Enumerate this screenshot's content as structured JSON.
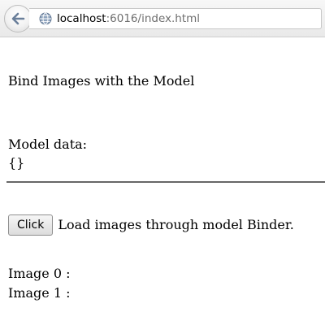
{
  "browser": {
    "url_host": "localhost",
    "url_rest": ":6016/index.html",
    "back_icon": "back-arrow-icon",
    "site_icon": "globe-icon"
  },
  "page": {
    "heading": "Bind Images with the Model",
    "model_label": "Model data:",
    "model_value": "{}",
    "button_label": "Click",
    "button_caption": "Load images through model Binder.",
    "images": [
      {
        "label": "Image 0 :"
      },
      {
        "label": "Image 1 :"
      }
    ]
  }
}
